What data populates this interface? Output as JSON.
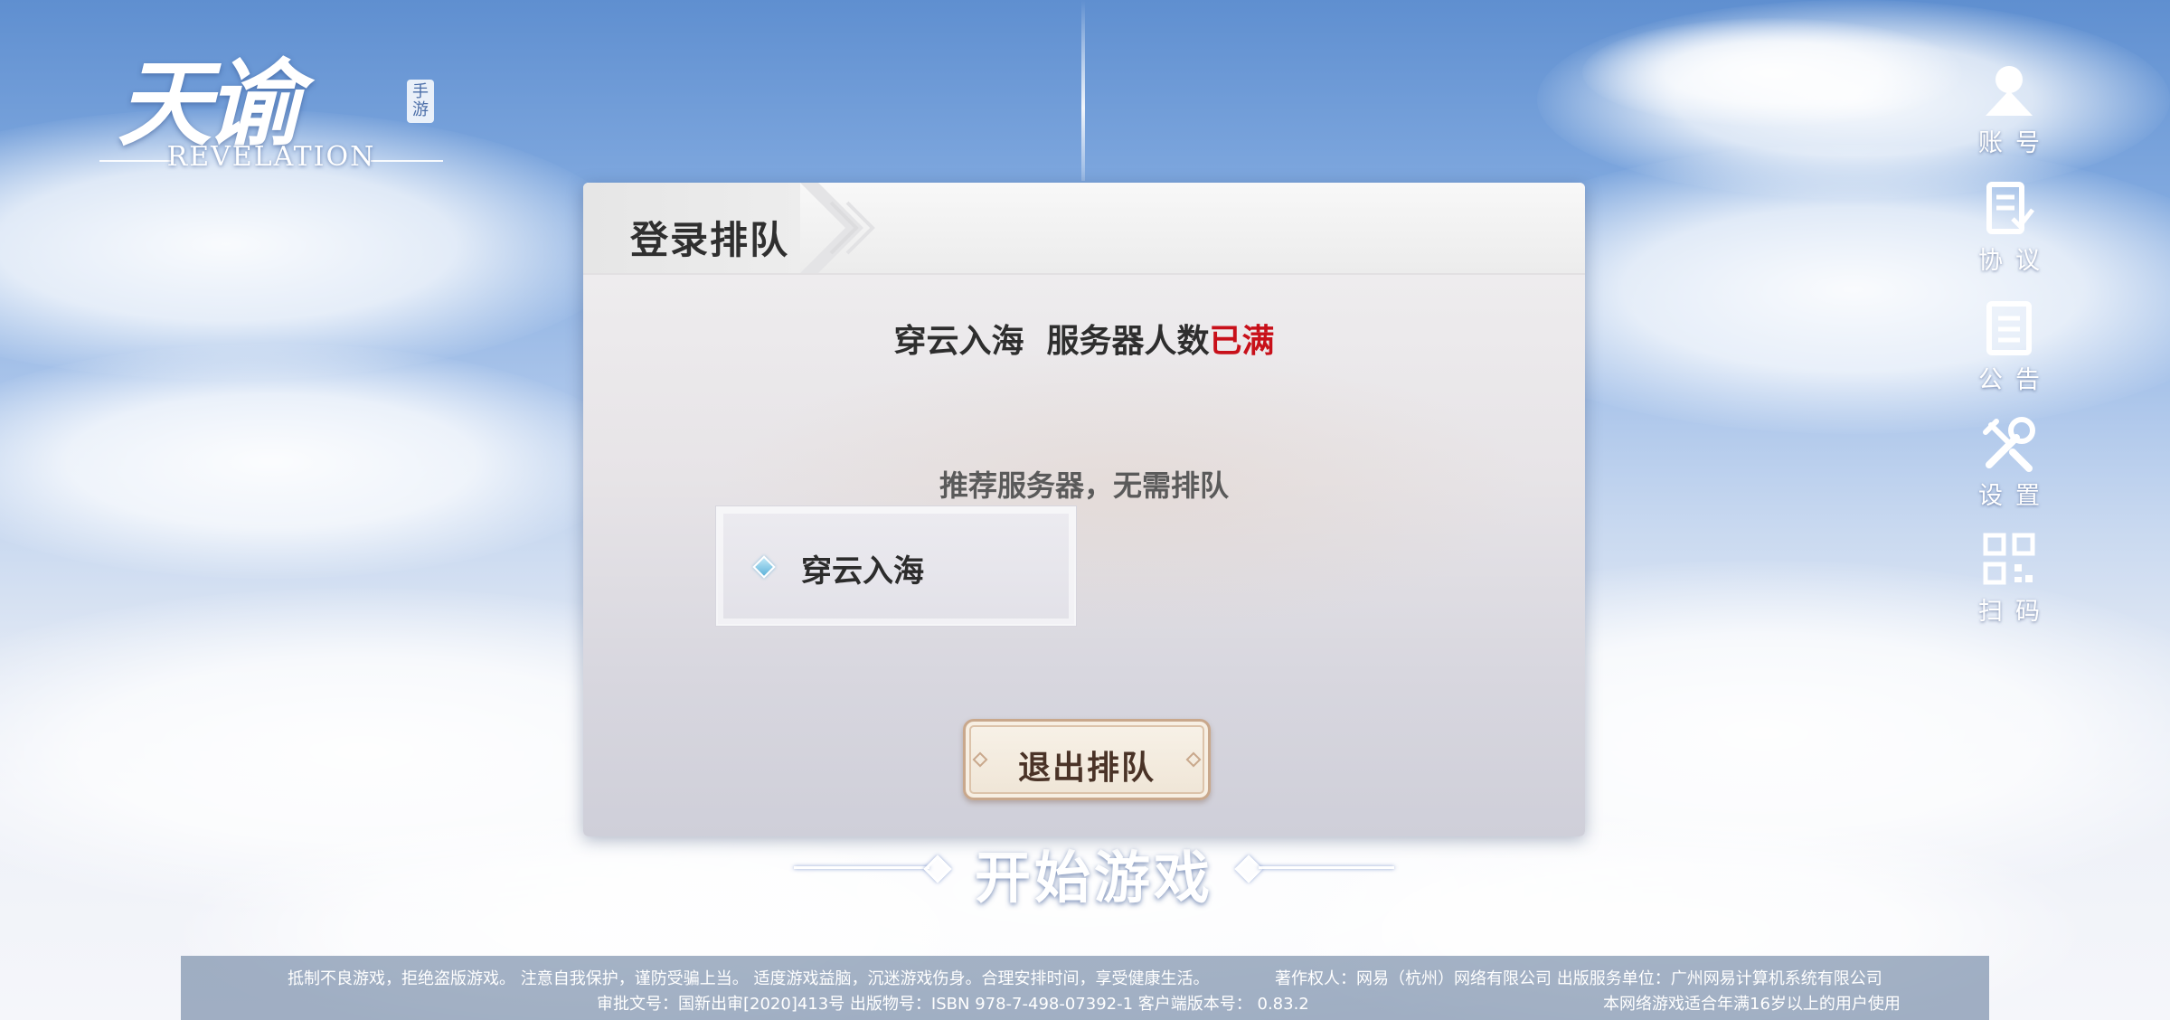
{
  "logo": {
    "title_cn": "天谕",
    "tag": "手游",
    "title_en": "REVELATION"
  },
  "sidebar": {
    "items": [
      {
        "label": "账号",
        "icon": "account-icon"
      },
      {
        "label": "协议",
        "icon": "agreement-icon"
      },
      {
        "label": "公告",
        "icon": "notice-icon"
      },
      {
        "label": "设置",
        "icon": "settings-icon"
      },
      {
        "label": "扫码",
        "icon": "qr-code-icon"
      }
    ]
  },
  "dialog": {
    "title": "登录排队",
    "status": {
      "server_name": "穿云入海",
      "status_text": "服务器人数",
      "status_highlight": "已满",
      "highlight_color": "#c8101a"
    },
    "recommend_label": "推荐服务器，无需排队",
    "recommended_server": {
      "name": "穿云入海"
    },
    "quit_button": "退出排队"
  },
  "start_game": "开始游戏",
  "footer": {
    "line1_left": "抵制不良游戏，拒绝盗版游戏。 注意自我保护，谨防受骗上当。 适度游戏益脑，沉迷游戏伤身。合理安排时间，享受健康生活。",
    "line1_right": "著作权人：网易（杭州）网络有限公司 出版服务单位：广州网易计算机系统有限公司",
    "line2_left": "审批文号：国新出审[2020]413号 出版物号：ISBN 978-7-498-07392-1  客户端版本号：  0.83.2",
    "line2_right": "本网络游戏适合年满16岁以上的用户使用"
  }
}
